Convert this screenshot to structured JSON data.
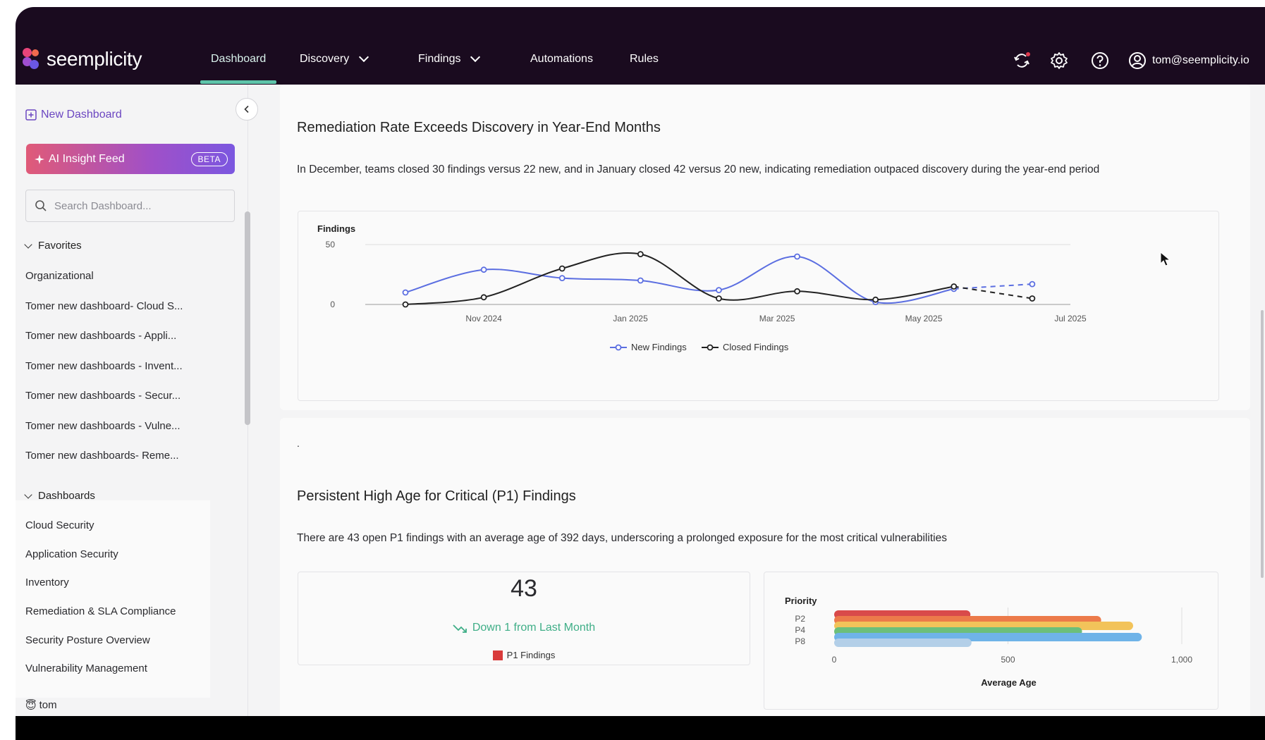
{
  "nav": {
    "logo": "seemplicity",
    "items": [
      {
        "label": "Dashboard"
      },
      {
        "label": "Discovery"
      },
      {
        "label": "Findings"
      },
      {
        "label": "Automations"
      },
      {
        "label": "Rules"
      }
    ],
    "user_email": "tom@seemplicity.io"
  },
  "sidebar": {
    "new_dashboard": "New Dashboard",
    "ai_feed": {
      "label": "AI Insight Feed",
      "badge": "BETA"
    },
    "search_placeholder": "Search Dashboard...",
    "favorites_label": "Favorites",
    "favorites": [
      "Organizational",
      "Tomer new dashboard- Cloud S...",
      "Tomer new dashboards - Appli...",
      "Tomer new dashboards - Invent...",
      "Tomer new dashboards - Secur...",
      "Tomer new dashboards - Vulne...",
      "Tomer new dashboards- Reme..."
    ],
    "dashboards_label": "Dashboards",
    "dashboards": [
      "Cloud Security",
      "Application Security",
      "Inventory",
      "Remediation & SLA Compliance",
      "Security Posture Overview",
      "Vulnerability Management"
    ],
    "user": {
      "emoji": "😇",
      "name": "tom"
    }
  },
  "insight1": {
    "title": "Remediation Rate Exceeds Discovery in Year-End Months",
    "description": "In December, teams closed 30 findings versus 22 new, and in January closed 42 versus 20 new, indicating remediation outpaced discovery during the year-end period"
  },
  "insight2": {
    "dot": ".",
    "title": "Persistent High Age for Critical (P1) Findings",
    "description": "There are 43 open P1 findings with an average age of 392 days, underscoring a prolonged exposure for the most critical vulnerabilities",
    "kpi": {
      "value": "43",
      "trend": "Down 1 from Last Month",
      "legend": "P1 Findings",
      "color": "#d93b3b"
    }
  },
  "colors": {
    "accent": "#5ec4a9",
    "new": "#5b6ee1",
    "closed": "#222222"
  },
  "chart_data": [
    {
      "type": "line",
      "ylabel": "Findings",
      "ylim": [
        0,
        50
      ],
      "yticks": [
        "0",
        "50"
      ],
      "xlim": [
        "2024-10",
        "2025-07"
      ],
      "xticks": [
        "Nov 2024",
        "Jan 2025",
        "Mar 2025",
        "May 2025",
        "Jul 2025"
      ],
      "x": [
        "2024-10",
        "2024-11",
        "2024-12",
        "2025-01",
        "2025-02",
        "2025-03",
        "2025-04",
        "2025-05",
        "2025-06"
      ],
      "series": [
        {
          "name": "New Findings",
          "color": "#5b6ee1",
          "values": [
            10,
            29,
            22,
            20,
            12,
            40,
            2,
            13,
            17
          ],
          "forecast_from": 7
        },
        {
          "name": "Closed Findings",
          "color": "#222222",
          "values": [
            0,
            6,
            30,
            42,
            5,
            11,
            4,
            15,
            5
          ],
          "forecast_from": 7
        }
      ],
      "legend": "bottom",
      "grid": true
    },
    {
      "type": "bar",
      "orientation": "horizontal",
      "ylabel": "Priority",
      "xlabel": "Average Age",
      "xlim": [
        0,
        1000
      ],
      "xticks": [
        "0",
        "500",
        "1,000"
      ],
      "categories": [
        "P2",
        "P4",
        "P8"
      ],
      "bars": [
        {
          "color": "#d94a4a",
          "value": 392
        },
        {
          "color": "#ec7a4a",
          "value": 768
        },
        {
          "color": "#f2c35a",
          "value": 860
        },
        {
          "color": "#6cbf7a",
          "value": 713
        },
        {
          "color": "#6fb3e8",
          "value": 885
        },
        {
          "color": "#b3cfe8",
          "value": 395
        }
      ]
    }
  ]
}
